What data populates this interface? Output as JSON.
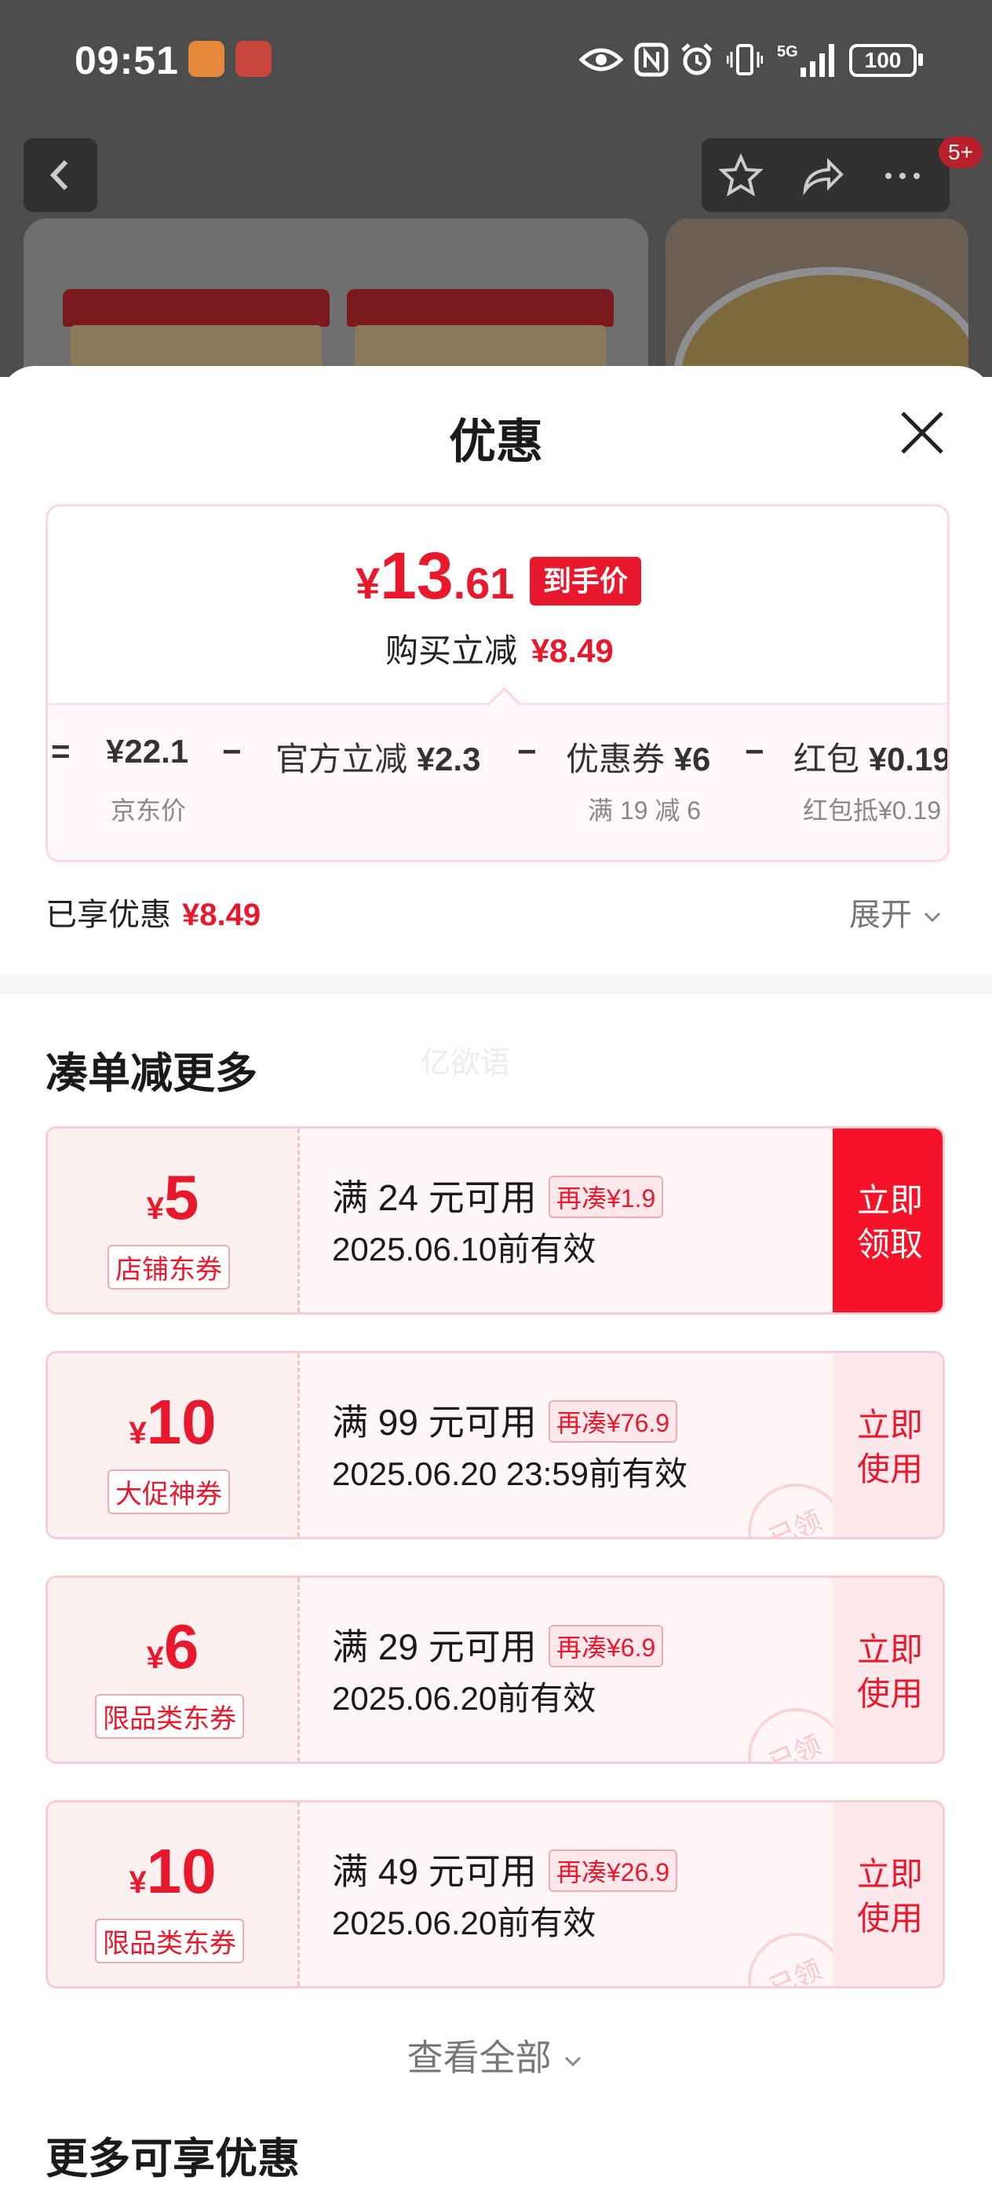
{
  "status_bar": {
    "time": "09:51",
    "battery": "100",
    "network": "5G"
  },
  "background": {
    "badge": "5+"
  },
  "sheet": {
    "title": "优惠",
    "price_card": {
      "currency": "¥",
      "final_int": "13",
      "final_dec": ".61",
      "final_tag": "到手价",
      "saving_label": "购买立减",
      "saving_amount": "¥8.49",
      "calc": [
        {
          "op": "=",
          "label": "",
          "value": "¥22.1",
          "sub": "京东价"
        },
        {
          "op": "−",
          "label": "官方立减",
          "value": "¥2.3",
          "sub": ""
        },
        {
          "op": "−",
          "label": "优惠券",
          "value": "¥6",
          "sub": "满 19 减 6"
        },
        {
          "op": "−",
          "label": "红包",
          "value": "¥0.19",
          "sub": "红包抵¥0.19"
        }
      ]
    },
    "enjoyed_label": "已享优惠",
    "enjoyed_amount": "¥8.49",
    "expand_label": "展开",
    "section_combine": "凑单减更多",
    "watermark": "亿欲语",
    "coupons": [
      {
        "currency": "¥",
        "amount": "5",
        "type": "店铺东券",
        "condition": "满 24 元可用",
        "more": "再凑¥1.9",
        "valid": "2025.06.10前有效",
        "action": "立即领取",
        "action_l1": "立即",
        "action_l2": "领取",
        "claimed": false,
        "stamp": ""
      },
      {
        "currency": "¥",
        "amount": "10",
        "type": "大促神券",
        "condition": "满 99 元可用",
        "more": "再凑¥76.9",
        "valid": "2025.06.20 23:59前有效",
        "action": "立即使用",
        "action_l1": "立即",
        "action_l2": "使用",
        "claimed": true,
        "stamp": "已领"
      },
      {
        "currency": "¥",
        "amount": "6",
        "type": "限品类东券",
        "condition": "满 29 元可用",
        "more": "再凑¥6.9",
        "valid": "2025.06.20前有效",
        "action": "立即使用",
        "action_l1": "立即",
        "action_l2": "使用",
        "claimed": true,
        "stamp": "已领"
      },
      {
        "currency": "¥",
        "amount": "10",
        "type": "限品类东券",
        "condition": "满 49 元可用",
        "more": "再凑¥26.9",
        "valid": "2025.06.20前有效",
        "action": "立即使用",
        "action_l1": "立即",
        "action_l2": "使用",
        "claimed": true,
        "stamp": "已领"
      }
    ],
    "view_all": "查看全部",
    "section_more": "更多可享优惠"
  },
  "colors": {
    "accent": "#e8192c",
    "button": "#f6132a",
    "border": "#f6cfd4"
  }
}
